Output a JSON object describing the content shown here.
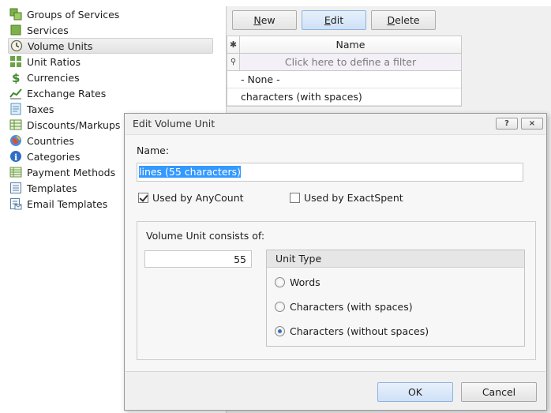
{
  "sidebar": {
    "items": [
      {
        "label": "Groups of Services",
        "icon": "groups-icon"
      },
      {
        "label": "Services",
        "icon": "services-icon"
      },
      {
        "label": "Volume Units",
        "icon": "clock-icon",
        "selected": true
      },
      {
        "label": "Unit Ratios",
        "icon": "ratios-icon"
      },
      {
        "label": "Currencies",
        "icon": "dollar-icon"
      },
      {
        "label": "Exchange Rates",
        "icon": "exchange-icon"
      },
      {
        "label": "Taxes",
        "icon": "taxes-icon"
      },
      {
        "label": "Discounts/Markups",
        "icon": "discounts-icon"
      },
      {
        "label": "Countries",
        "icon": "globe-icon"
      },
      {
        "label": "Categories",
        "icon": "info-icon"
      },
      {
        "label": "Payment Methods",
        "icon": "payment-icon"
      },
      {
        "label": "Templates",
        "icon": "templates-icon"
      },
      {
        "label": "Email Templates",
        "icon": "email-templates-icon"
      }
    ]
  },
  "toolbar": {
    "new_label": "New",
    "edit_label": "Edit",
    "delete_label": "Delete"
  },
  "grid": {
    "column_header": "Name",
    "filter_placeholder": "Click here to define a filter",
    "rows": [
      "- None -",
      "characters (with spaces)"
    ]
  },
  "dialog": {
    "title": "Edit Volume Unit",
    "help_label": "?",
    "close_label": "×",
    "name_label": "Name:",
    "name_value": "lines (55 characters)",
    "used_by_anycount": {
      "label": "Used by AnyCount",
      "checked": true
    },
    "used_by_exactspent": {
      "label": "Used by ExactSpent",
      "checked": false
    },
    "consists_label": "Volume Unit consists of:",
    "quantity": "55",
    "unit_type": {
      "header": "Unit Type",
      "options": [
        {
          "label": "Words",
          "selected": false
        },
        {
          "label": "Characters (with spaces)",
          "selected": false
        },
        {
          "label": "Characters (without spaces)",
          "selected": true
        }
      ]
    },
    "ok_label": "OK",
    "cancel_label": "Cancel"
  },
  "colors": {
    "accent": "#3399ff",
    "selected_button": "#cfe1f7"
  }
}
